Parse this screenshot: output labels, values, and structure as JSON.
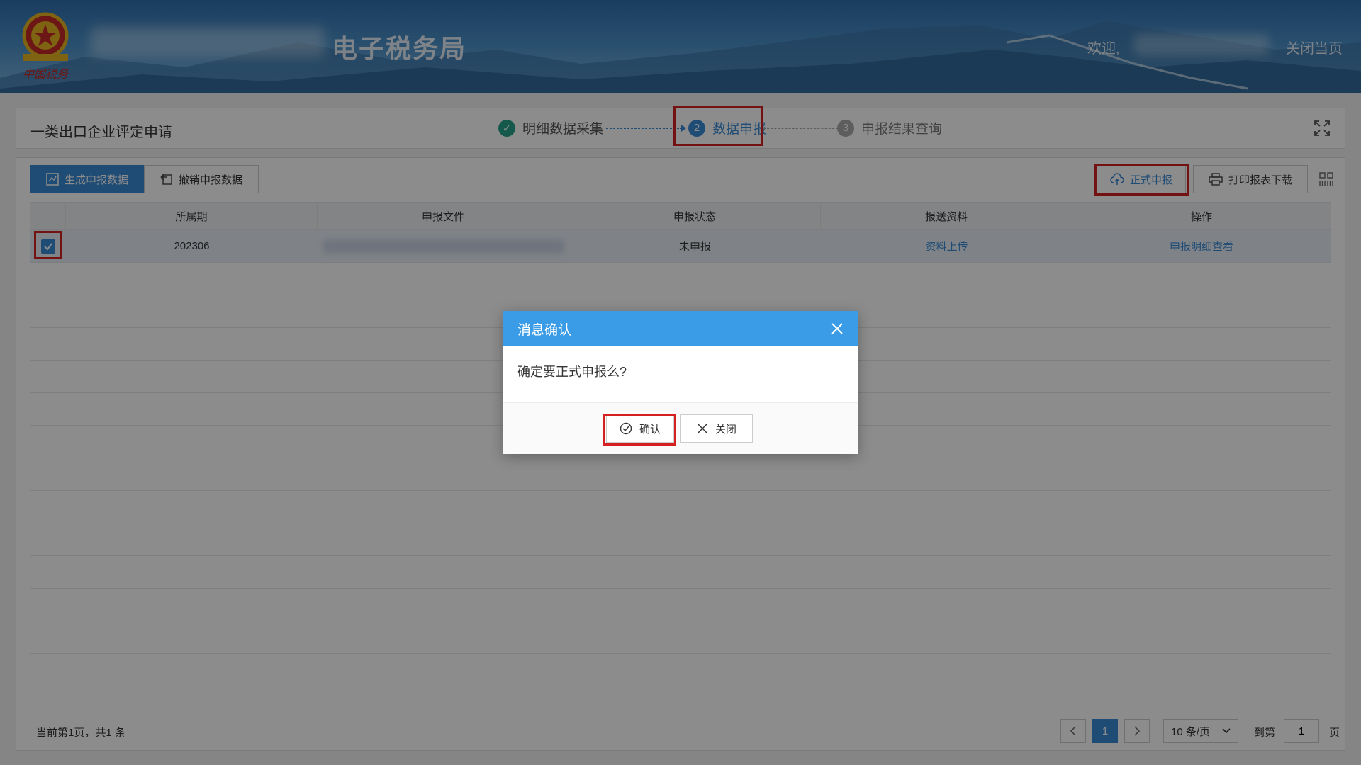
{
  "header": {
    "site_title": "电子税务局",
    "welcome_text": "欢迎,",
    "close_page": "关闭当页"
  },
  "steps": {
    "page_title": "一类出口企业评定申请",
    "items": [
      {
        "number": "✓",
        "label": "明细数据采集"
      },
      {
        "number": "2",
        "label": "数据申报"
      },
      {
        "number": "3",
        "label": "申报结果查询"
      }
    ]
  },
  "toolbar": {
    "generate_label": "生成申报数据",
    "cancel_label": "撤销申报数据",
    "submit_label": "正式申报",
    "print_label": "打印报表下载"
  },
  "table": {
    "headers": [
      "所属期",
      "申报文件",
      "申报状态",
      "报送资料",
      "操作"
    ],
    "rows": [
      {
        "period": "202306",
        "status": "未申报",
        "upload_link": "资料上传",
        "detail_link": "申报明细查看"
      }
    ]
  },
  "pagination": {
    "info": "当前第1页，共1 条",
    "current_page": "1",
    "page_size": "10 条/页",
    "goto_label": "到第",
    "goto_value": "1",
    "page_unit": "页"
  },
  "modal": {
    "title": "消息确认",
    "message": "确定要正式申报么?",
    "confirm_label": "确认",
    "close_label": "关闭"
  },
  "colors": {
    "primary": "#3a8ad6",
    "modal_header": "#3a9be6",
    "highlight_box": "#d42020",
    "step_done": "#27a38a"
  }
}
